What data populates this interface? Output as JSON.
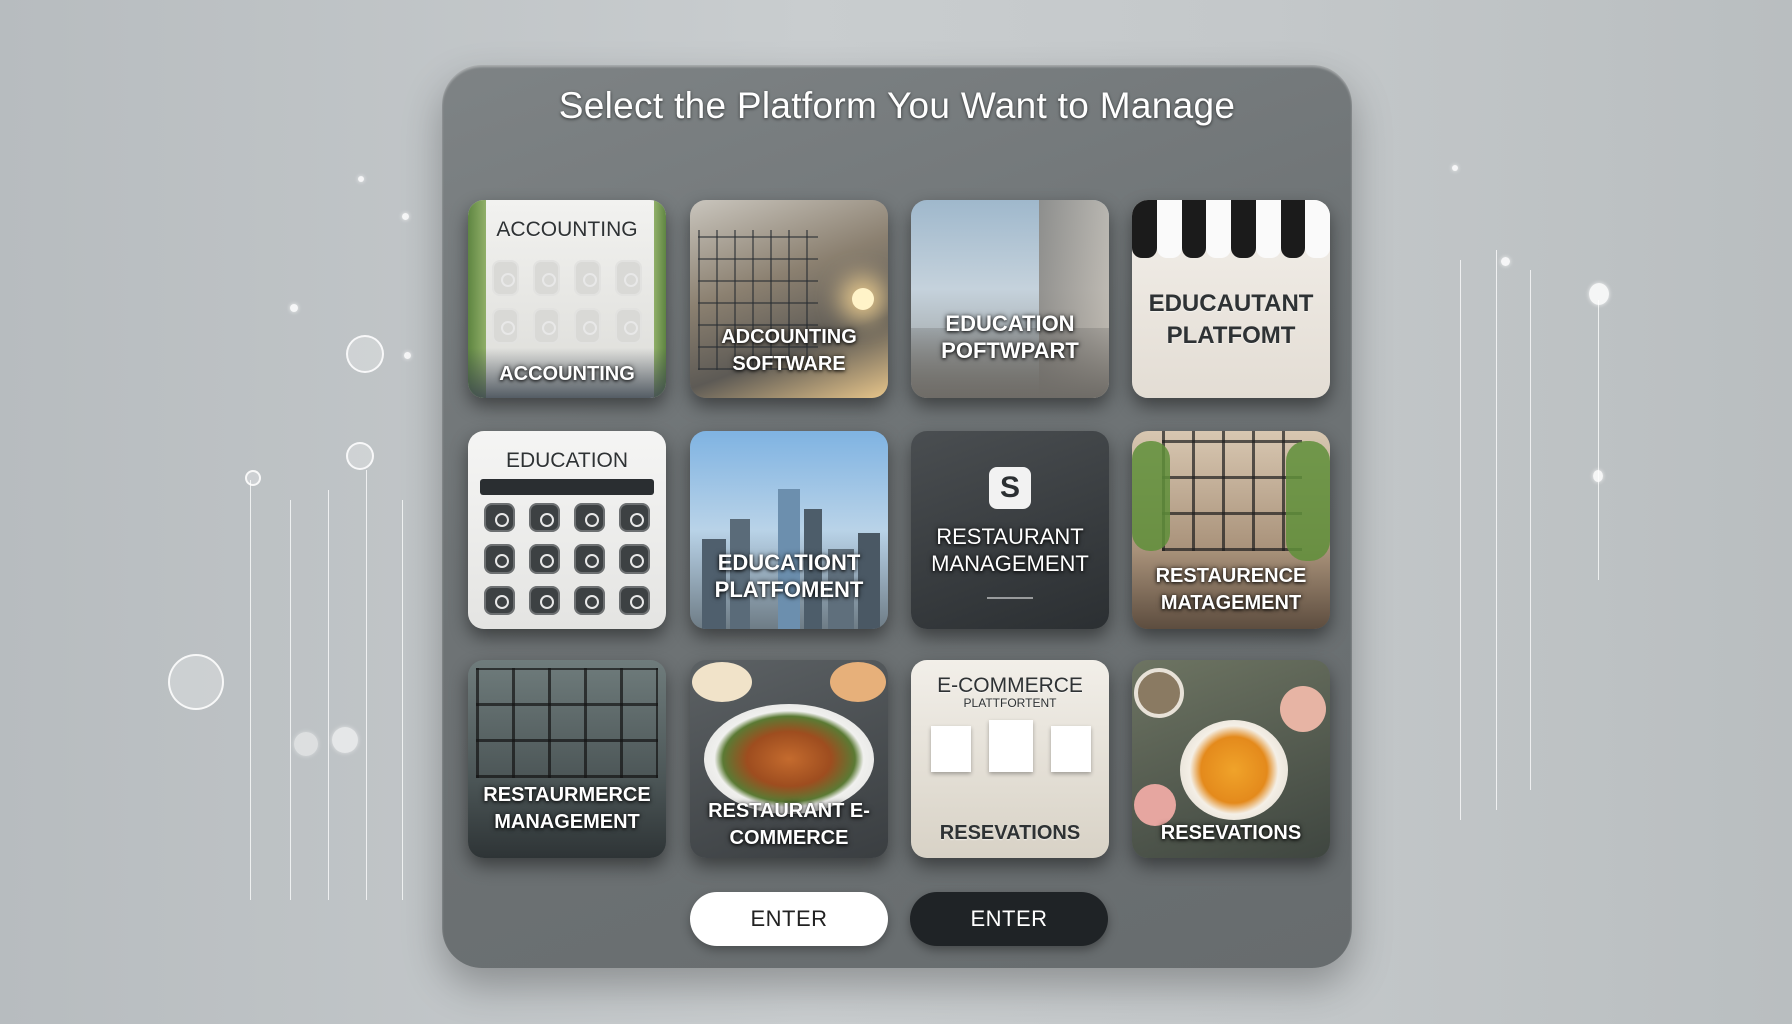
{
  "title": "Select the Platform You Want to Manage",
  "tiles": [
    {
      "top_label": "Accounting",
      "label": "Accounting",
      "icon": "accounting-grid-icon"
    },
    {
      "label": "Adcounting Software",
      "icon": "city-glass-building-icon"
    },
    {
      "label": "Education Poftwpart",
      "icon": "city-street-icon"
    },
    {
      "label": "Educautant Platfomt",
      "icon": "storefront-awning-icon"
    },
    {
      "top_label": "Education",
      "icon": "education-grid-icon"
    },
    {
      "label": "Educationt Platfoment",
      "icon": "skyline-icon"
    },
    {
      "label": "Restaurant Management",
      "icon": "s-logo-icon"
    },
    {
      "label": "Restaurence Matagement",
      "icon": "restaurant-interior-icon"
    },
    {
      "label": "Restaurmerce Management",
      "icon": "restaurant-window-icon"
    },
    {
      "label": "Restaurant E-Commerce",
      "icon": "food-plate-icon"
    },
    {
      "top_label": "E-Commerce",
      "sub_label": "Plattfortent",
      "label": "Resevations",
      "icon": "ecommerce-gallery-icon"
    },
    {
      "label": "Resevations",
      "icon": "food-bowl-icon"
    }
  ],
  "buttons": {
    "enter_light": "Enter",
    "enter_dark": "Enter"
  },
  "colors": {
    "panel": "#73787a",
    "button_dark": "#1f2326",
    "button_light": "#ffffff"
  }
}
